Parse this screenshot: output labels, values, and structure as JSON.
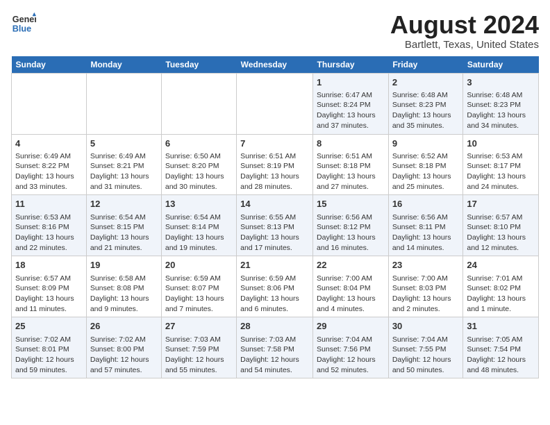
{
  "logo": {
    "line1": "General",
    "line2": "Blue"
  },
  "title": "August 2024",
  "subtitle": "Bartlett, Texas, United States",
  "weekdays": [
    "Sunday",
    "Monday",
    "Tuesday",
    "Wednesday",
    "Thursday",
    "Friday",
    "Saturday"
  ],
  "weeks": [
    [
      {
        "day": "",
        "info": ""
      },
      {
        "day": "",
        "info": ""
      },
      {
        "day": "",
        "info": ""
      },
      {
        "day": "",
        "info": ""
      },
      {
        "day": "1",
        "info": "Sunrise: 6:47 AM\nSunset: 8:24 PM\nDaylight: 13 hours and 37 minutes."
      },
      {
        "day": "2",
        "info": "Sunrise: 6:48 AM\nSunset: 8:23 PM\nDaylight: 13 hours and 35 minutes."
      },
      {
        "day": "3",
        "info": "Sunrise: 6:48 AM\nSunset: 8:23 PM\nDaylight: 13 hours and 34 minutes."
      }
    ],
    [
      {
        "day": "4",
        "info": "Sunrise: 6:49 AM\nSunset: 8:22 PM\nDaylight: 13 hours and 33 minutes."
      },
      {
        "day": "5",
        "info": "Sunrise: 6:49 AM\nSunset: 8:21 PM\nDaylight: 13 hours and 31 minutes."
      },
      {
        "day": "6",
        "info": "Sunrise: 6:50 AM\nSunset: 8:20 PM\nDaylight: 13 hours and 30 minutes."
      },
      {
        "day": "7",
        "info": "Sunrise: 6:51 AM\nSunset: 8:19 PM\nDaylight: 13 hours and 28 minutes."
      },
      {
        "day": "8",
        "info": "Sunrise: 6:51 AM\nSunset: 8:18 PM\nDaylight: 13 hours and 27 minutes."
      },
      {
        "day": "9",
        "info": "Sunrise: 6:52 AM\nSunset: 8:18 PM\nDaylight: 13 hours and 25 minutes."
      },
      {
        "day": "10",
        "info": "Sunrise: 6:53 AM\nSunset: 8:17 PM\nDaylight: 13 hours and 24 minutes."
      }
    ],
    [
      {
        "day": "11",
        "info": "Sunrise: 6:53 AM\nSunset: 8:16 PM\nDaylight: 13 hours and 22 minutes."
      },
      {
        "day": "12",
        "info": "Sunrise: 6:54 AM\nSunset: 8:15 PM\nDaylight: 13 hours and 21 minutes."
      },
      {
        "day": "13",
        "info": "Sunrise: 6:54 AM\nSunset: 8:14 PM\nDaylight: 13 hours and 19 minutes."
      },
      {
        "day": "14",
        "info": "Sunrise: 6:55 AM\nSunset: 8:13 PM\nDaylight: 13 hours and 17 minutes."
      },
      {
        "day": "15",
        "info": "Sunrise: 6:56 AM\nSunset: 8:12 PM\nDaylight: 13 hours and 16 minutes."
      },
      {
        "day": "16",
        "info": "Sunrise: 6:56 AM\nSunset: 8:11 PM\nDaylight: 13 hours and 14 minutes."
      },
      {
        "day": "17",
        "info": "Sunrise: 6:57 AM\nSunset: 8:10 PM\nDaylight: 13 hours and 12 minutes."
      }
    ],
    [
      {
        "day": "18",
        "info": "Sunrise: 6:57 AM\nSunset: 8:09 PM\nDaylight: 13 hours and 11 minutes."
      },
      {
        "day": "19",
        "info": "Sunrise: 6:58 AM\nSunset: 8:08 PM\nDaylight: 13 hours and 9 minutes."
      },
      {
        "day": "20",
        "info": "Sunrise: 6:59 AM\nSunset: 8:07 PM\nDaylight: 13 hours and 7 minutes."
      },
      {
        "day": "21",
        "info": "Sunrise: 6:59 AM\nSunset: 8:06 PM\nDaylight: 13 hours and 6 minutes."
      },
      {
        "day": "22",
        "info": "Sunrise: 7:00 AM\nSunset: 8:04 PM\nDaylight: 13 hours and 4 minutes."
      },
      {
        "day": "23",
        "info": "Sunrise: 7:00 AM\nSunset: 8:03 PM\nDaylight: 13 hours and 2 minutes."
      },
      {
        "day": "24",
        "info": "Sunrise: 7:01 AM\nSunset: 8:02 PM\nDaylight: 13 hours and 1 minute."
      }
    ],
    [
      {
        "day": "25",
        "info": "Sunrise: 7:02 AM\nSunset: 8:01 PM\nDaylight: 12 hours and 59 minutes."
      },
      {
        "day": "26",
        "info": "Sunrise: 7:02 AM\nSunset: 8:00 PM\nDaylight: 12 hours and 57 minutes."
      },
      {
        "day": "27",
        "info": "Sunrise: 7:03 AM\nSunset: 7:59 PM\nDaylight: 12 hours and 55 minutes."
      },
      {
        "day": "28",
        "info": "Sunrise: 7:03 AM\nSunset: 7:58 PM\nDaylight: 12 hours and 54 minutes."
      },
      {
        "day": "29",
        "info": "Sunrise: 7:04 AM\nSunset: 7:56 PM\nDaylight: 12 hours and 52 minutes."
      },
      {
        "day": "30",
        "info": "Sunrise: 7:04 AM\nSunset: 7:55 PM\nDaylight: 12 hours and 50 minutes."
      },
      {
        "day": "31",
        "info": "Sunrise: 7:05 AM\nSunset: 7:54 PM\nDaylight: 12 hours and 48 minutes."
      }
    ]
  ]
}
